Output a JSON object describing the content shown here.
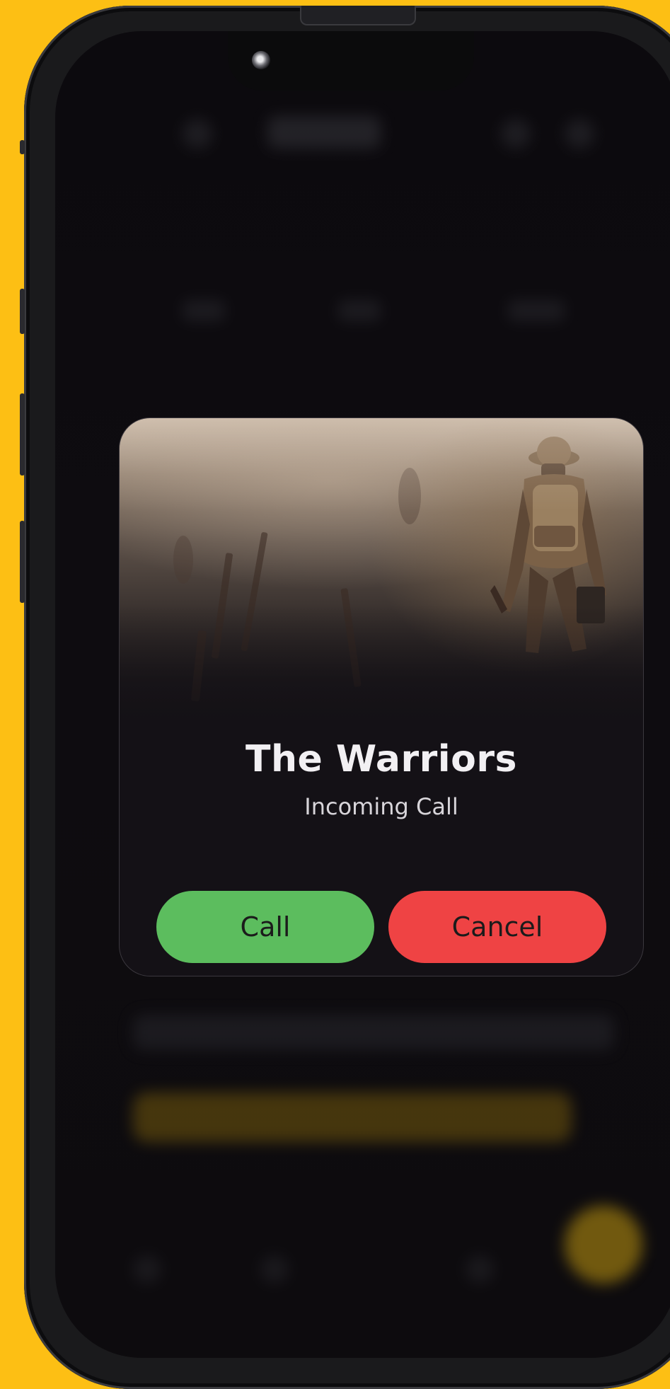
{
  "dialog": {
    "title": "The Warriors",
    "subtitle": "Incoming Call",
    "call_label": "Call",
    "cancel_label": "Cancel"
  },
  "colors": {
    "background": "#FDBF14",
    "call_button": "#5CBD5E",
    "cancel_button": "#EF4344",
    "card": "#141116"
  },
  "icons": [
    "camera-icon"
  ]
}
